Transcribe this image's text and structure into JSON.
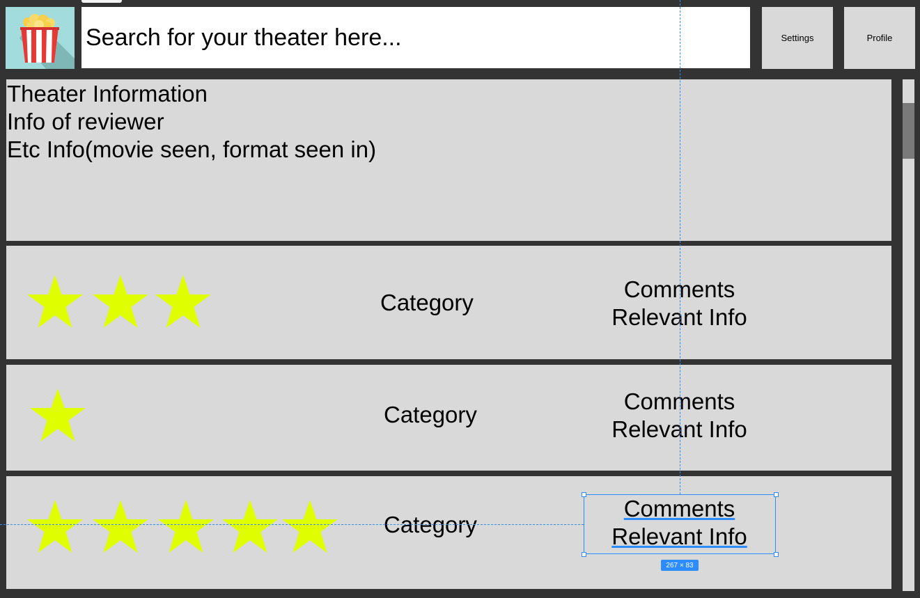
{
  "header": {
    "search_placeholder": "Search for your theater here...",
    "settings_label": "Settings",
    "profile_label": "Profile"
  },
  "info_panel": {
    "lines": [
      "Theater Information",
      "Info of reviewer",
      "Etc Info(movie seen, format seen in)"
    ]
  },
  "reviews": [
    {
      "rating": 3,
      "category": "Category",
      "comments": "Comments",
      "relevant": "Relevant Info"
    },
    {
      "rating": 1,
      "category": "Category",
      "comments": "Comments",
      "relevant": "Relevant Info"
    },
    {
      "rating": 5,
      "category": "Category",
      "comments": "Comments",
      "relevant": "Relevant Info"
    }
  ],
  "selection": {
    "size_label": "267 × 83"
  },
  "colors": {
    "star": "#dfff00",
    "panel": "#d9d9d9",
    "background": "#333333",
    "selection": "#2d8cff"
  },
  "icons": {
    "logo": "popcorn-icon",
    "rating": "star-icon"
  }
}
